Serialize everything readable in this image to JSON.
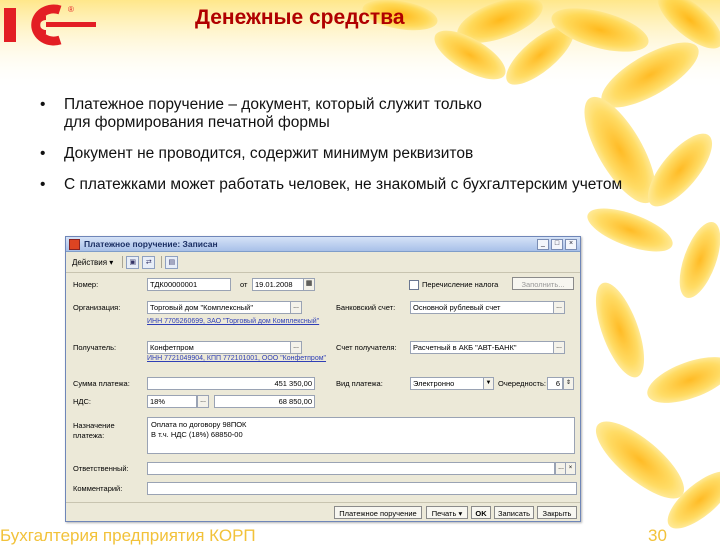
{
  "slide": {
    "title": "Денежные средства",
    "bullets": [
      "Платежное поручение – документ, который служит только для формирования печатной формы",
      "Документ не проводится, содержит минимум реквизитов",
      "С платежками может работать человек, не знакомый с бухгалтерским учетом"
    ],
    "footer": "Бухгалтерия предприятия КОРП",
    "page_number": "30",
    "bullet_glyph": "•",
    "colors": {
      "title": "#b00000",
      "footer": "#f2c23a",
      "logo": "#e31e24",
      "accent": "#ffd23f"
    }
  },
  "window": {
    "title": "Платежное поручение: Записан",
    "toolbar": {
      "actions_label": "Действия",
      "dropdown_glyph": "▾"
    },
    "fields": {
      "number_label": "Номер:",
      "number_value": "ТДК00000001",
      "from_label": "от",
      "date_value": "19.01.2008",
      "tax_transfer_label": "Перечисление налога",
      "fill_button": "Заполнить...",
      "org_label": "Организация:",
      "org_value": "Торговый дом \"Комплексный\"",
      "bank_account_label": "Банковский счет:",
      "bank_account_value": "Основной рублевый счет",
      "org_inn_link": "ИНН 7705260699, ЗАО \"Торговый дом Комплексный\"",
      "recipient_label": "Получатель:",
      "recipient_value": "Конфетпром",
      "recipient_account_label": "Счет получателя:",
      "recipient_account_value": "Расчетный в АКБ \"АВТ-БАНК\"",
      "recipient_inn_link": "ИНН 7721049904, КПП 772101001, ООО \"Конфетпром\"",
      "amount_label": "Сумма платежа:",
      "amount_value": "451 350,00",
      "payment_type_label": "Вид платежа:",
      "payment_type_value": "Электронно",
      "priority_label": "Очередность:",
      "priority_value": "6",
      "vat_label": "НДС:",
      "vat_rate": "18%",
      "vat_amount": "68 850,00",
      "purpose_label_1": "Назначение",
      "purpose_label_2": "платежа:",
      "purpose_line_1": "Оплата по договору 98ПОК",
      "purpose_line_2": "В т.ч. НДС  (18%) 68850-00",
      "responsible_label": "Ответственный:",
      "responsible_value": "",
      "comment_label": "Комментарий:",
      "comment_value": ""
    },
    "buttons": {
      "print_form": "Платежное поручение",
      "print": "Печать",
      "ok": "OK",
      "save": "Записать",
      "close": "Закрыть"
    },
    "icons": {
      "dots": "...",
      "dropdown": "▼",
      "spin": "⇕",
      "min": "_",
      "max": "□",
      "close": "×",
      "calendar": "▦"
    }
  }
}
